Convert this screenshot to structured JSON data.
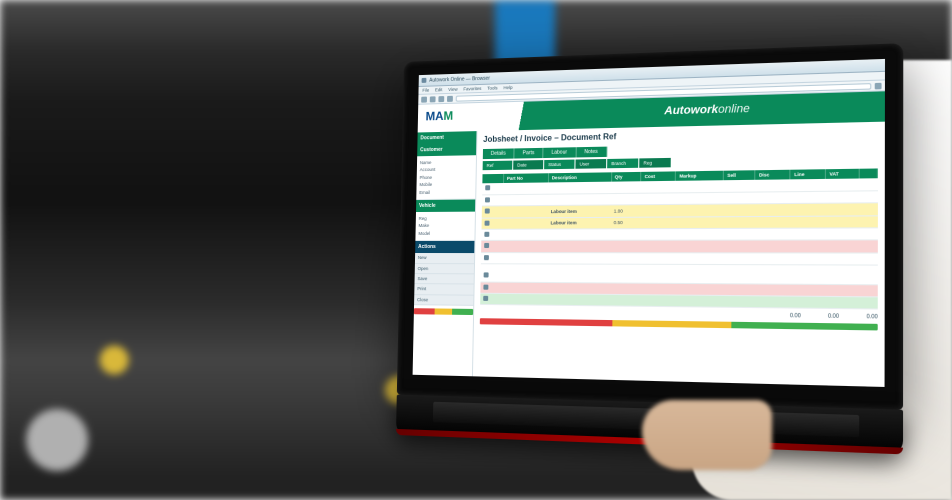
{
  "photo_caption": "Mechanic using laptop beside open car engine bay",
  "browser": {
    "title": "Autowork Online — Browser",
    "menus": [
      "File",
      "Edit",
      "View",
      "Favorites",
      "Tools",
      "Help"
    ]
  },
  "app": {
    "logo_text_1": "MA",
    "logo_text_2": "M",
    "title_main": "Autowork",
    "title_sub": "online"
  },
  "sidebar": {
    "head": "Document",
    "customer_label": "Customer",
    "rows": [
      {
        "l": "Name",
        "v": ""
      },
      {
        "l": "Account",
        "v": ""
      },
      {
        "l": "Phone",
        "v": ""
      },
      {
        "l": "Mobile",
        "v": ""
      },
      {
        "l": "Email",
        "v": ""
      }
    ],
    "vehicle_label": "Vehicle",
    "vrows": [
      {
        "l": "Reg",
        "v": ""
      },
      {
        "l": "Make",
        "v": ""
      },
      {
        "l": "Model",
        "v": ""
      }
    ],
    "dark_head": "Actions",
    "buttons": [
      "New",
      "Open",
      "Save",
      "Print",
      "Close"
    ]
  },
  "page": {
    "title": "Jobsheet / Invoice – Document Ref",
    "tabs": [
      "Details",
      "Parts",
      "Labour",
      "Notes"
    ],
    "info_cells": [
      "Ref",
      "Date",
      "Status",
      "User",
      "Branch",
      "Reg"
    ],
    "columns": [
      "",
      "Part No",
      "Description",
      "Qty",
      "Cost",
      "Markup",
      "Sell",
      "Disc",
      "Line",
      "VAT",
      ""
    ],
    "rows": [
      {
        "cls": "r-white",
        "c": [
          "",
          "",
          "",
          "",
          "",
          "",
          "",
          "",
          "",
          "",
          ""
        ]
      },
      {
        "cls": "r-white",
        "c": [
          "",
          "",
          "",
          "",
          "",
          "",
          "",
          "",
          "",
          "",
          ""
        ]
      },
      {
        "cls": "r-yellow",
        "c": [
          "",
          "",
          "Labour item",
          "1.00",
          "",
          "",
          "",
          "",
          "",
          "",
          ""
        ]
      },
      {
        "cls": "r-yellow",
        "c": [
          "",
          "",
          "Labour item",
          "0.50",
          "",
          "",
          "",
          "",
          "",
          "",
          ""
        ]
      },
      {
        "cls": "r-white",
        "c": [
          "",
          "",
          "",
          "",
          "",
          "",
          "",
          "",
          "",
          "",
          ""
        ]
      },
      {
        "cls": "r-pink",
        "c": [
          "",
          "",
          "",
          "",
          "",
          "",
          "",
          "",
          "",
          "",
          ""
        ]
      },
      {
        "cls": "r-white",
        "c": [
          "",
          "",
          "",
          "",
          "",
          "",
          "",
          "",
          "",
          "",
          ""
        ]
      }
    ],
    "rows2": [
      {
        "cls": "r-white",
        "c": [
          "",
          "",
          "",
          "",
          "",
          "",
          "",
          "",
          "",
          "",
          ""
        ]
      },
      {
        "cls": "r-pink",
        "c": [
          "",
          "",
          "",
          "",
          "",
          "",
          "",
          "",
          "",
          "",
          ""
        ]
      },
      {
        "cls": "r-green",
        "c": [
          "",
          "",
          "",
          "",
          "",
          "",
          "",
          "",
          "",
          "",
          ""
        ]
      }
    ],
    "totals": {
      "sub": "0.00",
      "vat": "0.00",
      "total": "0.00"
    }
  }
}
